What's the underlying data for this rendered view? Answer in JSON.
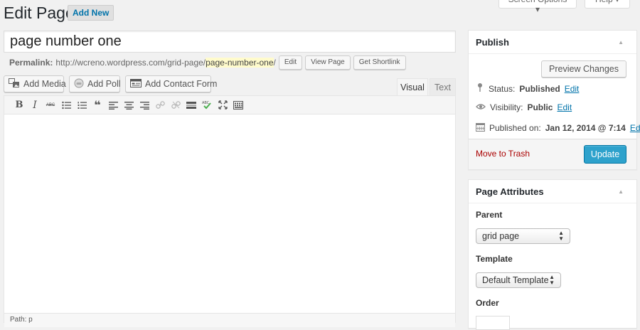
{
  "header": {
    "title": "Edit Page",
    "add_new": "Add New",
    "screen_options": "Screen Options ▾",
    "help": "Help ▾"
  },
  "post": {
    "title_value": "page number one",
    "permalink_label": "Permalink:",
    "permalink_base": "http://wcreno.wordpress.com/grid-page/",
    "permalink_slug": "page-number-one",
    "permalink_trailing": "/",
    "edit_btn": "Edit",
    "view_page_btn": "View Page",
    "get_shortlink_btn": "Get Shortlink"
  },
  "media_buttons": {
    "add_media": "Add Media",
    "add_poll": "Add Poll",
    "add_contact_form": "Add Contact Form"
  },
  "editor": {
    "tab_visual": "Visual",
    "tab_text": "Text",
    "toolbar": [
      "bold-icon",
      "italic-icon",
      "strikethrough-icon",
      "bullet-list-icon",
      "numbered-list-icon",
      "blockquote-icon",
      "align-left-icon",
      "align-center-icon",
      "align-right-icon",
      "insert-link-icon",
      "remove-link-icon",
      "read-more-icon",
      "spellcheck-icon",
      "fullscreen-icon",
      "kitchen-sink-icon"
    ],
    "bold_glyph": "B",
    "italic_glyph": "I",
    "strike_glyph": "ABC",
    "quote_glyph": "❝",
    "path": "Path: p"
  },
  "publish": {
    "title": "Publish",
    "preview": "Preview Changes",
    "status_label": "Status:",
    "status_value": "Published",
    "visibility_label": "Visibility:",
    "visibility_value": "Public",
    "published_label": "Published on:",
    "published_value": "Jan 12, 2014 @ 7:14",
    "edit_link": "Edit",
    "move_to_trash": "Move to Trash",
    "update": "Update"
  },
  "attributes": {
    "title": "Page Attributes",
    "parent_label": "Parent",
    "parent_value": "grid page",
    "template_label": "Template",
    "template_value": "Default Template",
    "order_label": "Order"
  },
  "colors": {
    "link": "#0073aa",
    "update_button": "#2ea2cc",
    "trash": "#aa0000",
    "slug_highlight": "#fffbcc"
  }
}
